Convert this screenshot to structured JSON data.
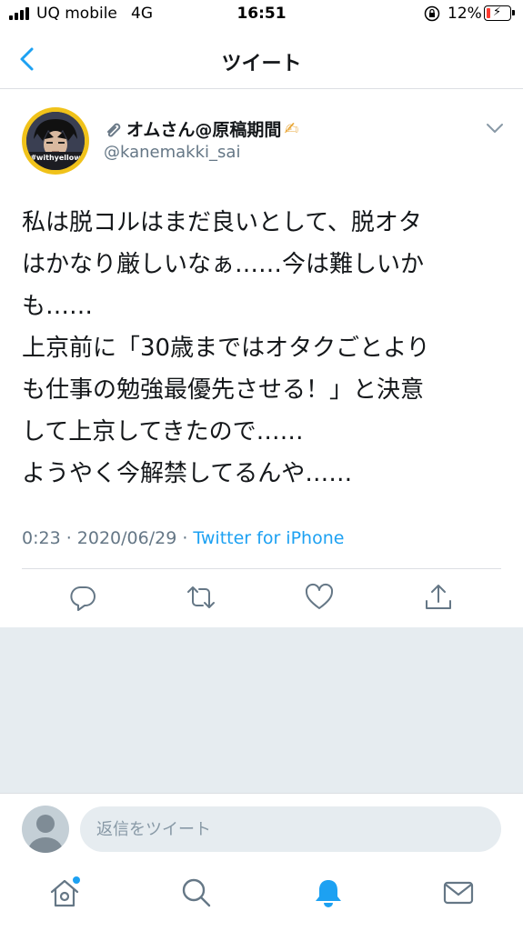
{
  "status_bar": {
    "carrier": "UQ mobile",
    "network": "4G",
    "time": "16:51",
    "battery_percent": "12%",
    "battery_level": 0.12,
    "icons": [
      "signal-bars",
      "rotation-lock",
      "battery-charging"
    ]
  },
  "nav": {
    "title": "ツイート",
    "back_icon": "chevron-left"
  },
  "tweet": {
    "display_name": "オムさん@原稿期間",
    "handle": "@kanemakki_sai",
    "avatar_tag": "#withyellow",
    "text": "私は脱コルはまだ良いとして、脱オタ\nはかなり厳しいなぁ……今は難しいか\nも……\n上京前に「30歳まではオタクごとより\nも仕事の勉強最優先させる！」と決意\nして上京してきたので……\nようやく今解禁してるんや……",
    "timestamp": "0:23 · 2020/06/29 · ",
    "source": "Twitter for iPhone"
  },
  "actions": [
    "reply-icon",
    "retweet-icon",
    "like-icon",
    "share-icon"
  ],
  "reply_bar": {
    "placeholder": "返信をツイート"
  },
  "tab_bar": {
    "tabs": [
      "home-icon",
      "search-icon",
      "notifications-icon",
      "messages-icon"
    ],
    "active_color": "#1da1f2"
  },
  "colors": {
    "accent": "#1da1f2",
    "secondary_text": "#657786",
    "background_gray": "#e6ecf0",
    "avatar_ring": "#f0c21a"
  }
}
